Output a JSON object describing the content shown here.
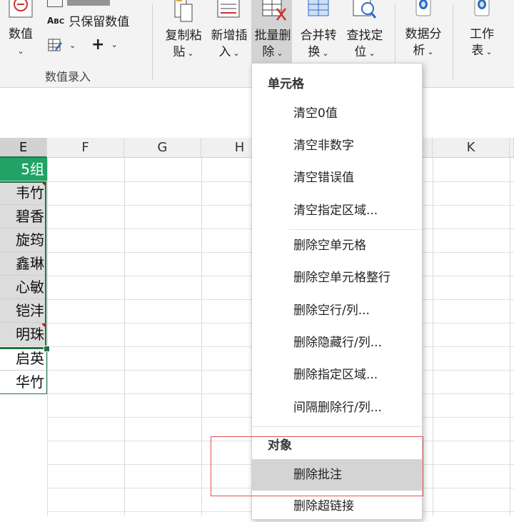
{
  "ribbon": {
    "numeric": {
      "label": "数值"
    },
    "keep_numeric": {
      "label": "只保留数值"
    },
    "group_label": "数值录入",
    "copy_paste": {
      "line1": "复制粘",
      "line2": "贴"
    },
    "insert": {
      "line1": "新增插",
      "line2": "入"
    },
    "batch_delete": {
      "line1": "批量删",
      "line2": "除"
    },
    "merge": {
      "line1": "合并转",
      "line2": "换"
    },
    "find": {
      "line1": "查找定",
      "line2": "位"
    },
    "data_analysis": {
      "line1": "数据分",
      "line2": "析"
    },
    "worksheet": {
      "line1": "工作",
      "line2": "表"
    },
    "plus_symbol": "+"
  },
  "grid": {
    "columns": [
      "E",
      "F",
      "G",
      "H",
      "K"
    ],
    "e_cells": [
      "5组",
      "韦竹",
      "碧香",
      "旋筠",
      "鑫琳",
      "心敏",
      "铠沣",
      "明珠",
      "启英",
      "华竹"
    ]
  },
  "menu": {
    "section_cells": "单元格",
    "items_cells": [
      "清空0值",
      "清空非数字",
      "清空错误值",
      "清空指定区域..."
    ],
    "items_delete": [
      "删除空单元格",
      "删除空单元格整行",
      "删除空行/列...",
      "删除隐藏行/列...",
      "删除指定区域...",
      "间隔删除行/列..."
    ],
    "section_objects": "对象",
    "items_objects": [
      "删除批注",
      "删除超链接"
    ]
  },
  "colors": {
    "accent": "#217346",
    "header_green": "#21a366",
    "highlight": "#d4d4d4",
    "annotation_red": "#e05050"
  }
}
